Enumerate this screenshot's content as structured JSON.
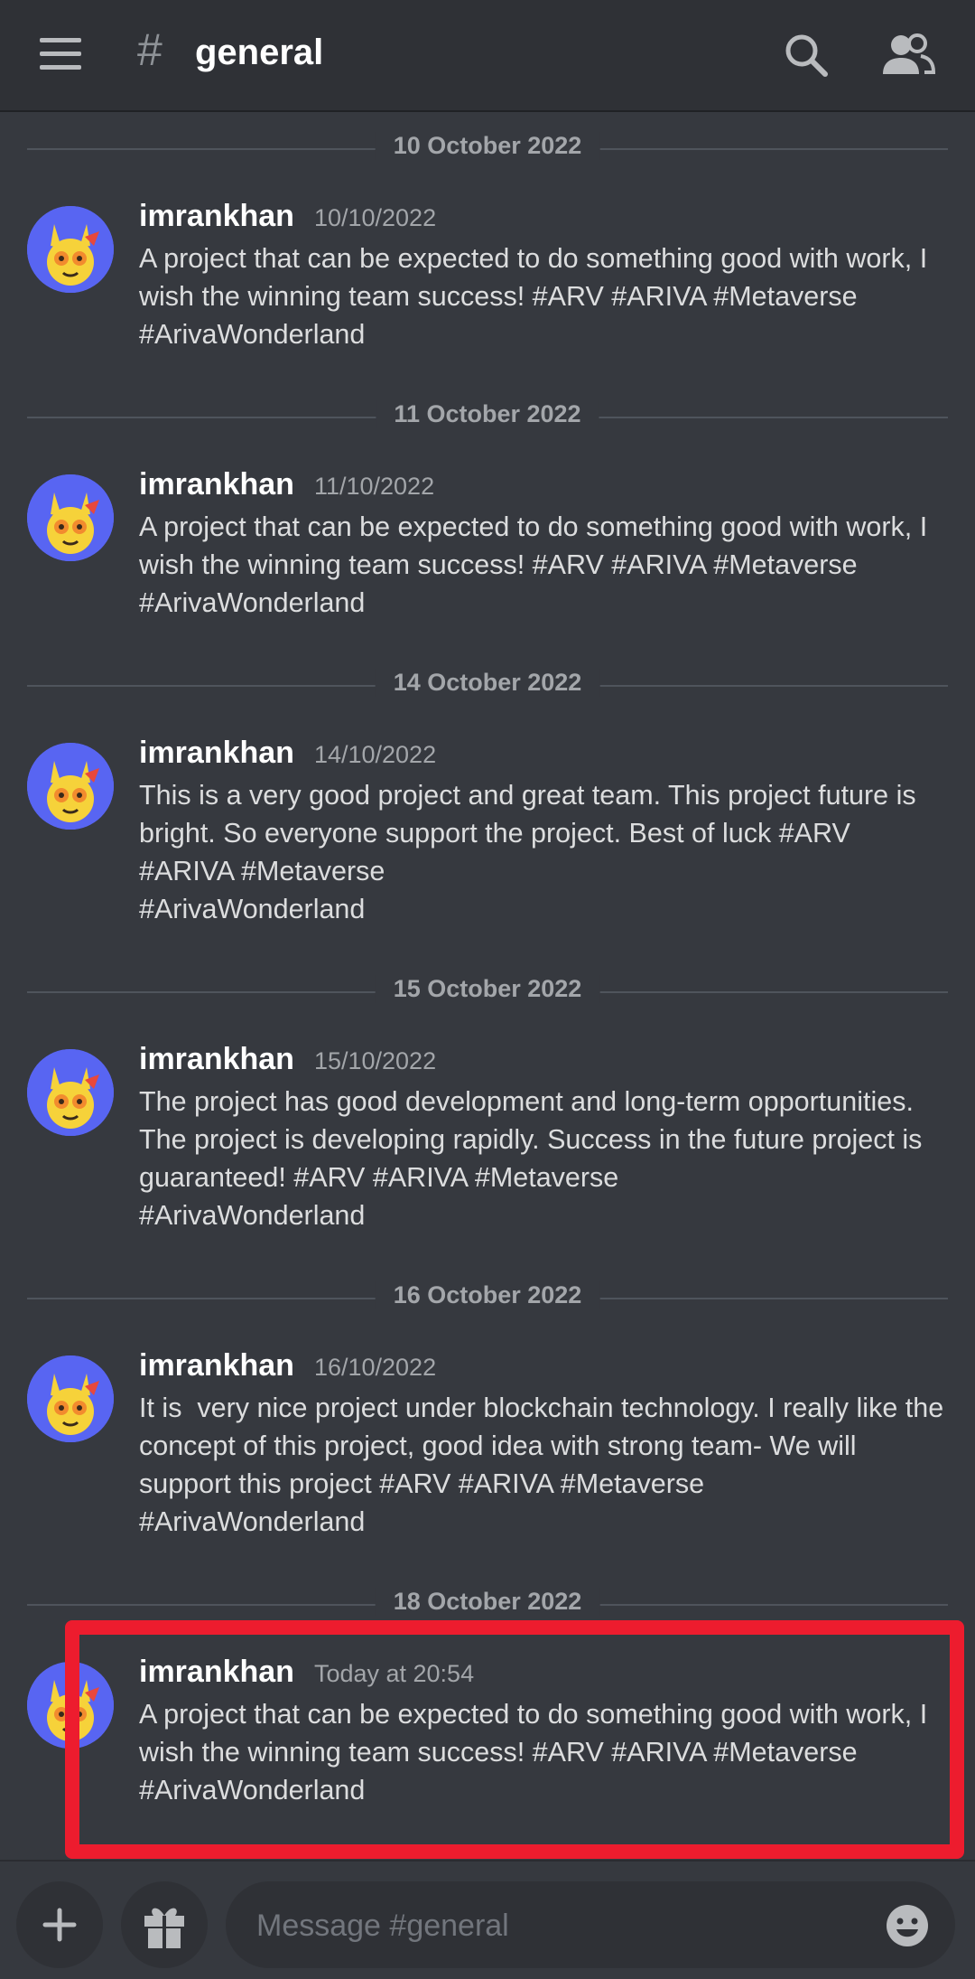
{
  "header": {
    "channel_name": "general"
  },
  "messages": [
    {
      "date": "10 October 2022",
      "username": "imrankhan",
      "timestamp": "10/10/2022",
      "text": "A project that can be expected to do something good with work, I wish the winning team success! #ARV #ARIVA #Metaverse #ArivaWonderland"
    },
    {
      "date": "11 October 2022",
      "username": "imrankhan",
      "timestamp": "11/10/2022",
      "text": "A project that can be expected to do something good with work, I wish the winning team success! #ARV #ARIVA #Metaverse #ArivaWonderland"
    },
    {
      "date": "14 October 2022",
      "username": "imrankhan",
      "timestamp": "14/10/2022",
      "text": "This is a very good project and great team. This project future is bright. So everyone support the project. Best of luck #ARV #ARIVA #Metaverse\n#ArivaWonderland"
    },
    {
      "date": "15 October 2022",
      "username": "imrankhan",
      "timestamp": "15/10/2022",
      "text": "The project has good development and long-term opportunities. The project is developing rapidly. Success in the future project is guaranteed! #ARV #ARIVA #Metaverse\n#ArivaWonderland"
    },
    {
      "date": "16 October 2022",
      "username": "imrankhan",
      "timestamp": "16/10/2022",
      "text": "It is  very nice project under blockchain technology. I really like the concept of this project, good idea with strong team- We will support this project #ARV #ARIVA #Metaverse\n#ArivaWonderland"
    },
    {
      "date": "18 October 2022",
      "username": "imrankhan",
      "timestamp": "Today at 20:54",
      "text": "A project that can be expected to do something good with work, I wish the winning team success! #ARV #ARIVA #Metaverse #ArivaWonderland"
    }
  ],
  "composer": {
    "placeholder": "Message #general"
  },
  "colors": {
    "background": "#36393f",
    "header": "#2f3136",
    "highlight": "#ed1c2e",
    "avatar": "#5865f2"
  }
}
